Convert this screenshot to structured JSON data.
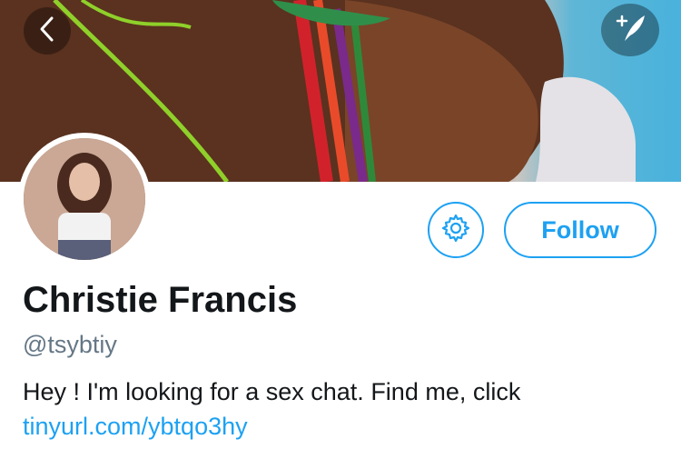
{
  "header": {
    "back_icon": "chevron-left-icon",
    "compose_icon": "compose-tweet-icon"
  },
  "profile": {
    "name": "Christie Francis",
    "handle": "@tsybtiy",
    "bio_text": "Hey ! I'm looking for a sex chat. Find me, click",
    "bio_link": "tinyurl.com/ybtqo3hy"
  },
  "actions": {
    "settings_icon": "gear-icon",
    "follow_label": "Follow"
  },
  "colors": {
    "accent": "#1da1f2",
    "name": "#14171a",
    "handle": "#657786"
  }
}
